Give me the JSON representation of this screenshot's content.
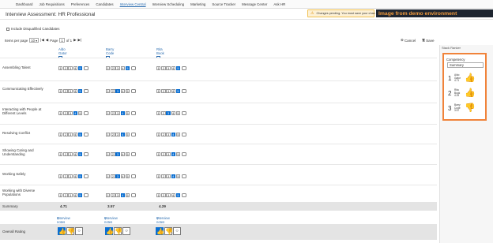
{
  "nav": {
    "items": [
      "Dashboard",
      "Job Requisitions",
      "Preferences",
      "Candidates",
      "Interview Central",
      "Interview Scheduling",
      "Marketing",
      "Source Tracker",
      "Message Center",
      "Ask HR"
    ],
    "active_index": 4
  },
  "header": {
    "title": "Interview Assessment: HR Professional",
    "warning": "Changes pending. You must save your chan",
    "banner": "Image from demo environment"
  },
  "toolbar": {
    "include_disqualified": "Include Disqualified Candidates",
    "items_per_page_label": "Items per page",
    "items_per_page_value": "10",
    "page_label": "Page",
    "page_value": "1",
    "page_of": "of 1",
    "cancel": "Cancel",
    "save": "Save"
  },
  "candidates": [
    {
      "first": "Aldo",
      "last": "Gator"
    },
    {
      "first": "Barry",
      "last": "Code"
    },
    {
      "first": "Rita",
      "last": "Book"
    }
  ],
  "competencies": [
    {
      "label": "Assembling Talent",
      "ratings": [
        5,
        5,
        5
      ]
    },
    {
      "label": "Communicating Effectively",
      "ratings": [
        5,
        3,
        5
      ]
    },
    {
      "label": "Interacting with People at Different Levels",
      "ratings": [
        4,
        4,
        3
      ]
    },
    {
      "label": "Resolving Conflict",
      "ratings": [
        5,
        4,
        4
      ]
    },
    {
      "label": "Showing Caring and Understanding",
      "ratings": [
        5,
        3,
        4
      ]
    },
    {
      "label": "Working Safely",
      "ratings": [
        5,
        3,
        4
      ]
    },
    {
      "label": "Working with Diverse Populations",
      "ratings": [
        5,
        4,
        5
      ]
    }
  ],
  "scale": [
    "1",
    "2",
    "3",
    "4",
    "5"
  ],
  "summary": {
    "label": "Summary",
    "values": [
      "4.71",
      "3.57",
      "4.29"
    ]
  },
  "interview_notes": "Interview notes",
  "overall": {
    "label": "Overall Rating",
    "selection": [
      "up",
      "up",
      "up"
    ]
  },
  "stack_ranker": {
    "title": "Stack Ranker",
    "competency_label": "Competency",
    "competency_value": "Summary",
    "ranks": [
      {
        "num": "1",
        "first": "Aldo",
        "last": "Gator",
        "score": "4.71",
        "thumb": "up"
      },
      {
        "num": "2",
        "first": "Rita",
        "last": "Book",
        "score": "4.29",
        "thumb": "up"
      },
      {
        "num": "3",
        "first": "Barry",
        "last": "Code",
        "score": "3.57",
        "thumb": "down"
      }
    ]
  },
  "colors": {
    "accent": "#0a6ed1",
    "highlight": "#f0833a",
    "banner_text": "#f29b3d"
  }
}
